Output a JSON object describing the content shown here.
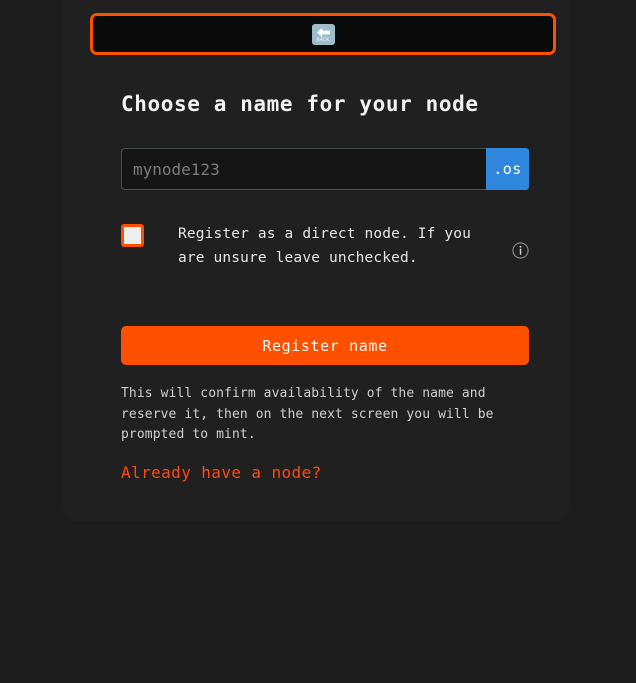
{
  "back_bar": {
    "icon": "back-arrow-image",
    "label": "BACK"
  },
  "heading": "Choose a name for your node",
  "name_field": {
    "placeholder": "mynode123",
    "value": "",
    "suffix": ".os"
  },
  "direct_node": {
    "checked": false,
    "label": "Register as a direct node. If you are unsure leave unchecked.",
    "info_icon": "info-circle-icon"
  },
  "primary_action": {
    "label": "Register name"
  },
  "help_text": "This will confirm availability of the name and reserve it, then on the next screen you will be prompted to mint.",
  "existing_node_link": "Already have a node?",
  "colors": {
    "accent": "#ff5000",
    "link": "#ff4a12",
    "suffix_blue": "#2f86dd",
    "page_background": "#1c1c1c",
    "card_background": "#202020",
    "back_bar_fill": "#0b0a0a"
  }
}
